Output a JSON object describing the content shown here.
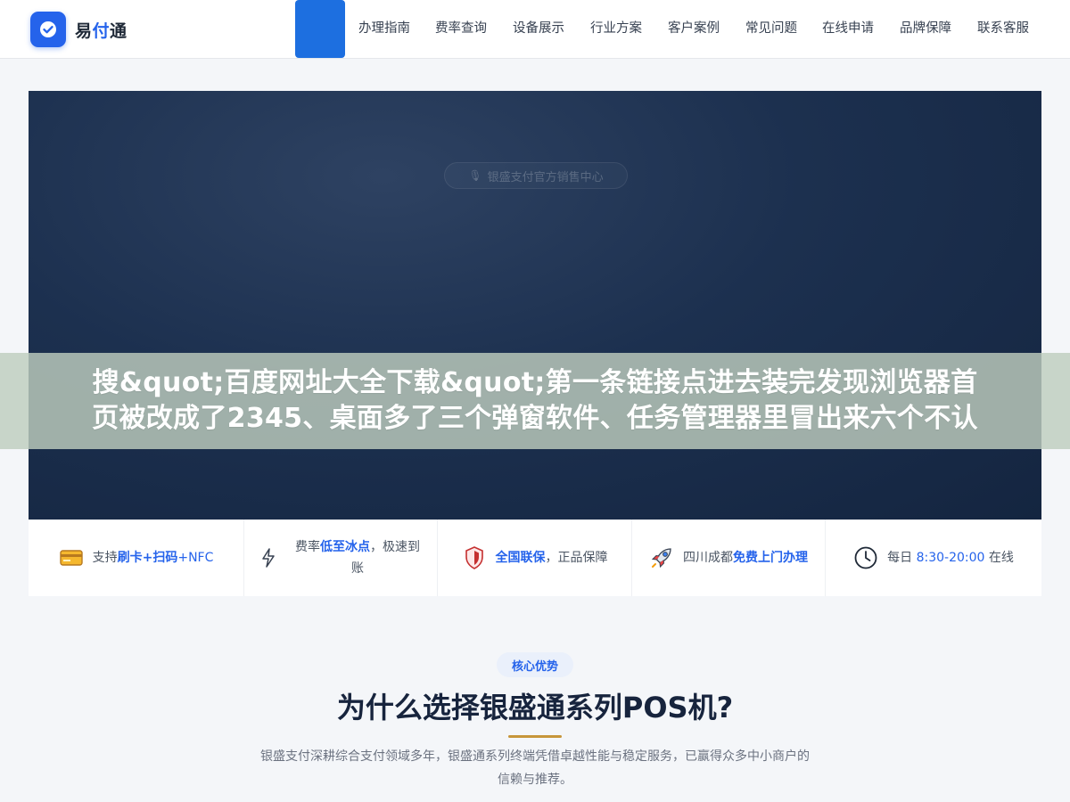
{
  "brand": {
    "name_part1": "易",
    "name_accent": "付",
    "name_part2": "通",
    "color": "#2563eb"
  },
  "nav": {
    "items": [
      "办理指南",
      "费率查询",
      "设备展示",
      "行业方案",
      "客户案例",
      "常见问题",
      "在线申请",
      "品牌保障",
      "联系客服"
    ],
    "active_color": "#1d6fe0"
  },
  "hero": {
    "badge": "银盛支付官方销售中心",
    "banner_lines": [
      "搜&quot;百度网址大全下载&quot;第一条链接点进去装完发现浏览器首",
      "页被改成了2345、桌面多了三个弹窗软件、任务管理器里冒出来六个不认"
    ]
  },
  "features": [
    {
      "icon": "card-icon",
      "pre": "支持",
      "hl": "刷卡+扫码",
      "post": "+NFC",
      "post_hl": true
    },
    {
      "icon": "lightning-icon",
      "pre": "费率",
      "hl": "低至冰点",
      "post": "，极速到账",
      "post_hl": false
    },
    {
      "icon": "shield-icon",
      "pre": "",
      "hl": "全国联保",
      "post": "，正品保障",
      "post_hl": false
    },
    {
      "icon": "rocket-icon",
      "pre": "四川成都",
      "hl": "免费上门办理",
      "post": "",
      "post_hl": false
    },
    {
      "icon": "clock-icon",
      "pre": "每日 ",
      "hl": "8:30-20:00",
      "post": " 在线",
      "post_hl": false
    }
  ],
  "section": {
    "tag": "核心优势",
    "title": "为什么选择银盛通系列POS机?",
    "description": "银盛支付深耕综合支付领域多年，银盛通系列终端凭借卓越性能与稳定服务，已赢得众多中小商户的信赖与推荐。",
    "rule_color": "#c7963a"
  }
}
